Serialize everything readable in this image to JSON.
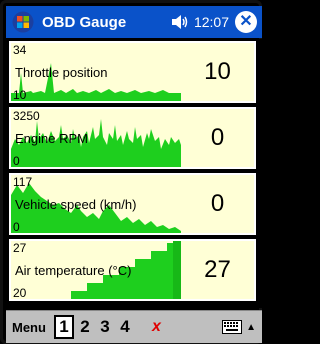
{
  "titlebar": {
    "title": "OBD Gauge",
    "time": "12:07"
  },
  "gauges": [
    {
      "max": "34",
      "min": "10",
      "name": "Throttle position",
      "value": "10"
    },
    {
      "max": "3250",
      "min": "0",
      "name": "Engine RPM",
      "value": "0"
    },
    {
      "max": "117",
      "min": "0",
      "name": "Vehicle speed (km/h)",
      "value": "0"
    },
    {
      "max": "27",
      "min": "20",
      "name": "Air temperature (°C)",
      "value": "27"
    }
  ],
  "menubar": {
    "menu": "Menu",
    "tabs": [
      "1",
      "2",
      "3",
      "4"
    ],
    "active_tab": "1",
    "x_label": "x"
  },
  "colors": {
    "graph": "#1ecf1e",
    "graph_dark": "#0fa60f",
    "panel": "#ffffd6",
    "titlebar": "#0a52c9"
  }
}
